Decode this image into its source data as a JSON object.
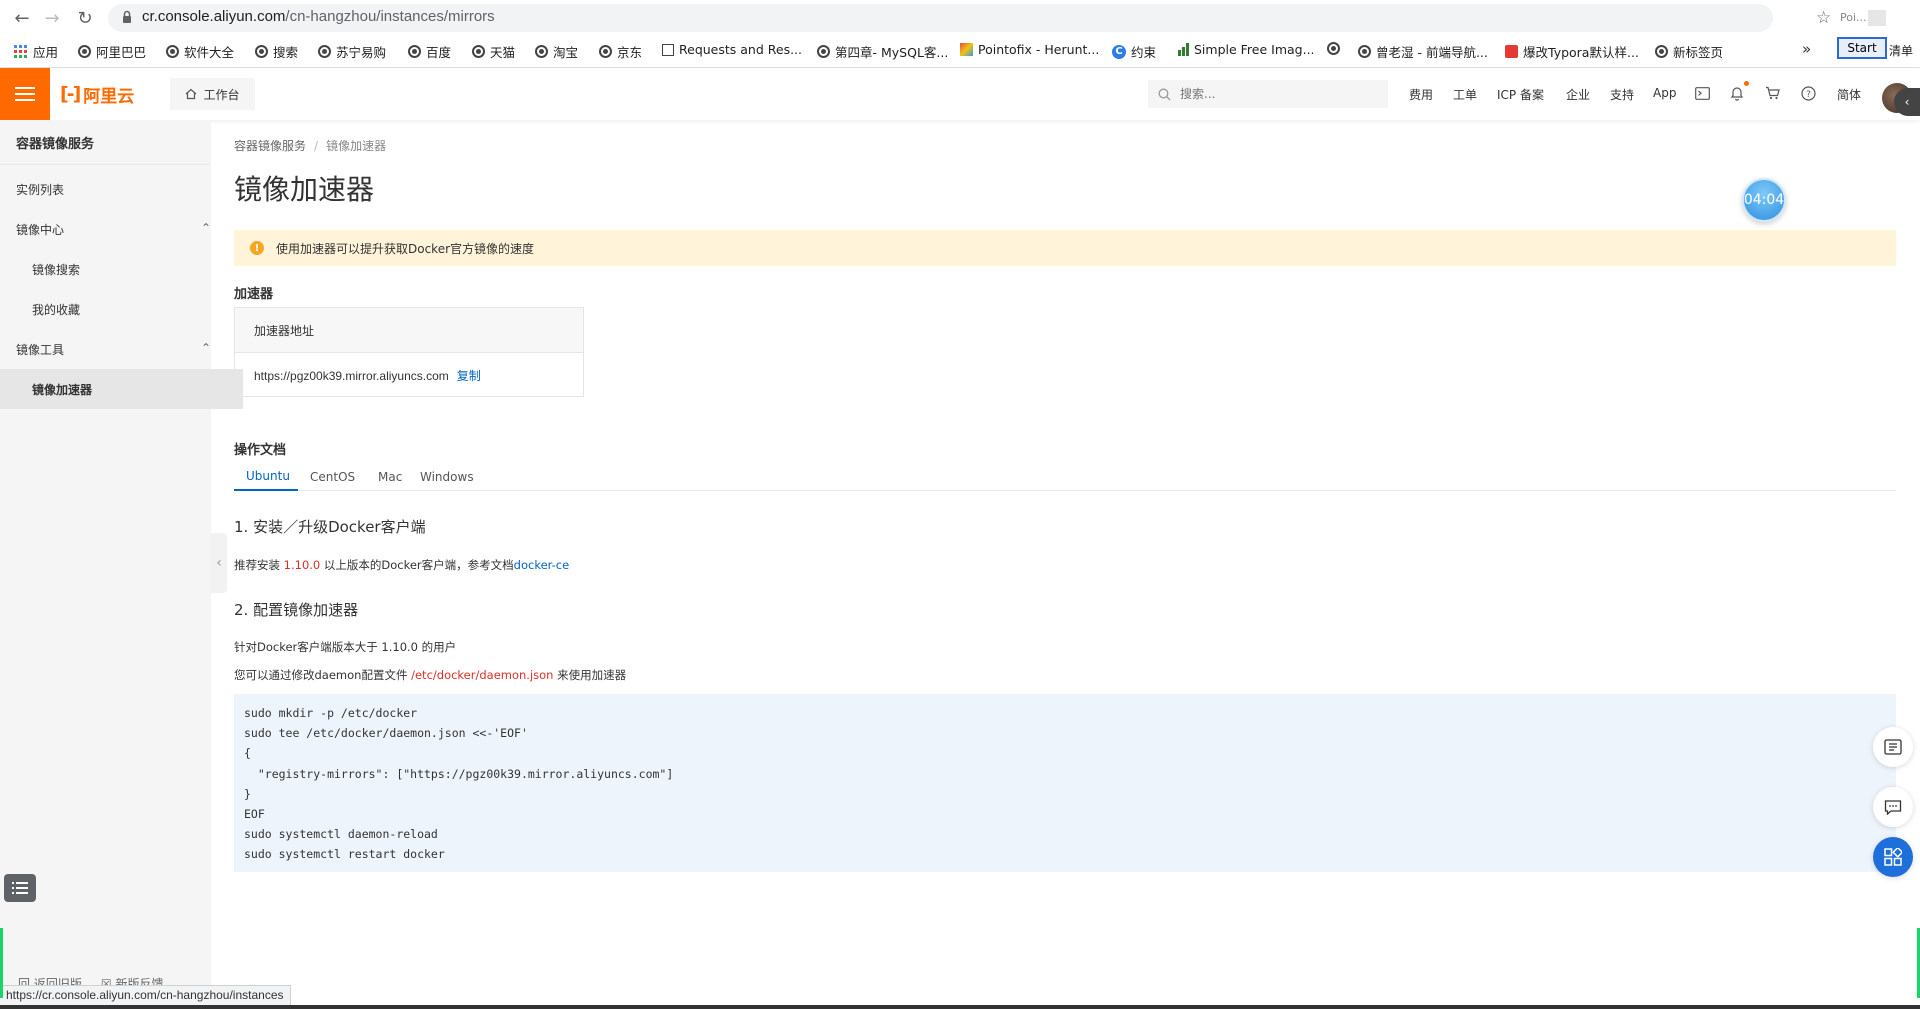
{
  "browser": {
    "url_host": "cr.console.aliyun.com",
    "url_path": "/cn-hangzhou/instances/mirrors",
    "extension_label": "Poi...",
    "bookmarks": [
      {
        "label": "应用"
      },
      {
        "label": "阿里巴巴"
      },
      {
        "label": "软件大全"
      },
      {
        "label": "搜索"
      },
      {
        "label": "苏宁易购"
      },
      {
        "label": "百度"
      },
      {
        "label": "天猫"
      },
      {
        "label": "淘宝"
      },
      {
        "label": "京东"
      },
      {
        "label": "Requests and Res..."
      },
      {
        "label": "第四章- MySQL客..."
      },
      {
        "label": "Pointofix - Herunt..."
      },
      {
        "label": "约束"
      },
      {
        "label": "Simple Free Imag..."
      },
      {
        "label": ""
      },
      {
        "label": "曾老湿 - 前端导航..."
      },
      {
        "label": "爆改Typora默认样..."
      },
      {
        "label": "新标签页"
      }
    ],
    "more_label": "»",
    "start_label": "Start",
    "tail_label": "清单",
    "status_url": "https://cr.console.aliyun.com/cn-hangzhou/instances"
  },
  "console": {
    "logo_text": "阿里云",
    "workbench_label": "工作台",
    "search_placeholder": "搜索...",
    "nav": [
      "费用",
      "工单",
      "ICP 备案",
      "企业",
      "支持",
      "App"
    ],
    "lang_label": "简体"
  },
  "sidebar": {
    "title": "容器镜像服务",
    "items": [
      {
        "label": "实例列表"
      },
      {
        "label": "镜像中心"
      },
      {
        "label": "镜像搜索"
      },
      {
        "label": "我的收藏"
      },
      {
        "label": "镜像工具"
      },
      {
        "label": "镜像加速器"
      }
    ],
    "bottom_text": "回 返回旧版     ☒ 新版反馈"
  },
  "main": {
    "breadcrumb": [
      "容器镜像服务",
      "镜像加速器"
    ],
    "title": "镜像加速器",
    "timer": "04:04",
    "notice": "使用加速器可以提升获取Docker官方镜像的速度",
    "accelerator": {
      "section_title": "加速器",
      "column_header": "加速器地址",
      "address": "https://pgz00k39.mirror.aliyuncs.com",
      "copy_label": "复制"
    },
    "docs": {
      "section_title": "操作文档",
      "tabs": [
        "Ubuntu",
        "CentOS",
        "Mac",
        "Windows"
      ],
      "step1_title": "1. 安装／升级Docker客户端",
      "step1_pre": "推荐安装 ",
      "step1_version": "1.10.0",
      "step1_mid": " 以上版本的Docker客户端，参考文档",
      "step1_link": "docker-ce",
      "step2_title": "2. 配置镜像加速器",
      "step2_line1": "针对Docker客户端版本大于 1.10.0 的用户",
      "step2_line2_pre": "您可以通过修改daemon配置文件 ",
      "step2_path": "/etc/docker/daemon.json",
      "step2_line2_post": " 来使用加速器",
      "code": [
        "sudo mkdir -p /etc/docker",
        "sudo tee /etc/docker/daemon.json <<-'EOF'",
        "{",
        "  \"registry-mirrors\": [\"https://pgz00k39.mirror.aliyuncs.com\"]",
        "}",
        "EOF",
        "sudo systemctl daemon-reload",
        "sudo systemctl restart docker"
      ]
    }
  },
  "colors": {
    "brand": "#ff6a00",
    "link": "#0064c8",
    "notice_bg": "#fff4d9"
  }
}
